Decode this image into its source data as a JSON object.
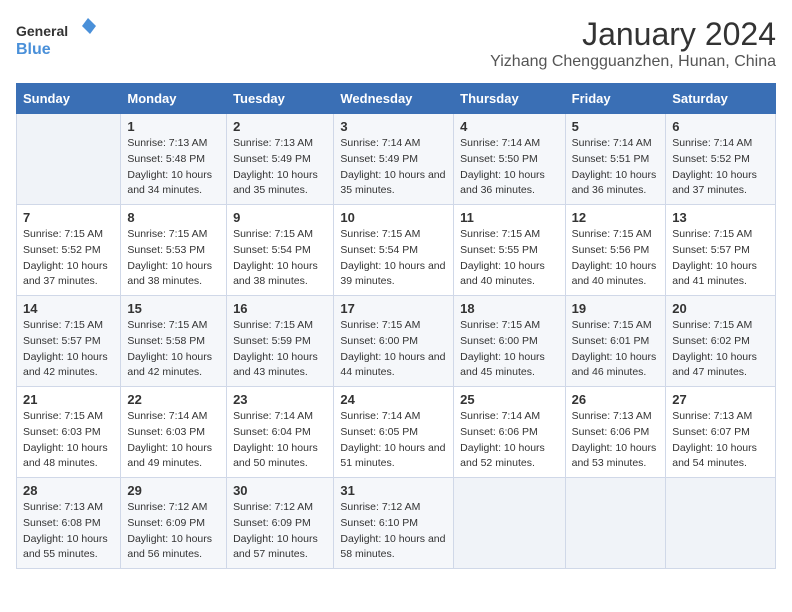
{
  "header": {
    "logo_line1": "General",
    "logo_line2": "Blue",
    "month": "January 2024",
    "location": "Yizhang Chengguanzhen, Hunan, China"
  },
  "days_of_week": [
    "Sunday",
    "Monday",
    "Tuesday",
    "Wednesday",
    "Thursday",
    "Friday",
    "Saturday"
  ],
  "weeks": [
    [
      {
        "day": "",
        "sunrise": "",
        "sunset": "",
        "daylight": ""
      },
      {
        "day": "1",
        "sunrise": "7:13 AM",
        "sunset": "5:48 PM",
        "daylight": "10 hours and 34 minutes."
      },
      {
        "day": "2",
        "sunrise": "7:13 AM",
        "sunset": "5:49 PM",
        "daylight": "10 hours and 35 minutes."
      },
      {
        "day": "3",
        "sunrise": "7:14 AM",
        "sunset": "5:49 PM",
        "daylight": "10 hours and 35 minutes."
      },
      {
        "day": "4",
        "sunrise": "7:14 AM",
        "sunset": "5:50 PM",
        "daylight": "10 hours and 36 minutes."
      },
      {
        "day": "5",
        "sunrise": "7:14 AM",
        "sunset": "5:51 PM",
        "daylight": "10 hours and 36 minutes."
      },
      {
        "day": "6",
        "sunrise": "7:14 AM",
        "sunset": "5:52 PM",
        "daylight": "10 hours and 37 minutes."
      }
    ],
    [
      {
        "day": "7",
        "sunrise": "7:15 AM",
        "sunset": "5:52 PM",
        "daylight": "10 hours and 37 minutes."
      },
      {
        "day": "8",
        "sunrise": "7:15 AM",
        "sunset": "5:53 PM",
        "daylight": "10 hours and 38 minutes."
      },
      {
        "day": "9",
        "sunrise": "7:15 AM",
        "sunset": "5:54 PM",
        "daylight": "10 hours and 38 minutes."
      },
      {
        "day": "10",
        "sunrise": "7:15 AM",
        "sunset": "5:54 PM",
        "daylight": "10 hours and 39 minutes."
      },
      {
        "day": "11",
        "sunrise": "7:15 AM",
        "sunset": "5:55 PM",
        "daylight": "10 hours and 40 minutes."
      },
      {
        "day": "12",
        "sunrise": "7:15 AM",
        "sunset": "5:56 PM",
        "daylight": "10 hours and 40 minutes."
      },
      {
        "day": "13",
        "sunrise": "7:15 AM",
        "sunset": "5:57 PM",
        "daylight": "10 hours and 41 minutes."
      }
    ],
    [
      {
        "day": "14",
        "sunrise": "7:15 AM",
        "sunset": "5:57 PM",
        "daylight": "10 hours and 42 minutes."
      },
      {
        "day": "15",
        "sunrise": "7:15 AM",
        "sunset": "5:58 PM",
        "daylight": "10 hours and 42 minutes."
      },
      {
        "day": "16",
        "sunrise": "7:15 AM",
        "sunset": "5:59 PM",
        "daylight": "10 hours and 43 minutes."
      },
      {
        "day": "17",
        "sunrise": "7:15 AM",
        "sunset": "6:00 PM",
        "daylight": "10 hours and 44 minutes."
      },
      {
        "day": "18",
        "sunrise": "7:15 AM",
        "sunset": "6:00 PM",
        "daylight": "10 hours and 45 minutes."
      },
      {
        "day": "19",
        "sunrise": "7:15 AM",
        "sunset": "6:01 PM",
        "daylight": "10 hours and 46 minutes."
      },
      {
        "day": "20",
        "sunrise": "7:15 AM",
        "sunset": "6:02 PM",
        "daylight": "10 hours and 47 minutes."
      }
    ],
    [
      {
        "day": "21",
        "sunrise": "7:15 AM",
        "sunset": "6:03 PM",
        "daylight": "10 hours and 48 minutes."
      },
      {
        "day": "22",
        "sunrise": "7:14 AM",
        "sunset": "6:03 PM",
        "daylight": "10 hours and 49 minutes."
      },
      {
        "day": "23",
        "sunrise": "7:14 AM",
        "sunset": "6:04 PM",
        "daylight": "10 hours and 50 minutes."
      },
      {
        "day": "24",
        "sunrise": "7:14 AM",
        "sunset": "6:05 PM",
        "daylight": "10 hours and 51 minutes."
      },
      {
        "day": "25",
        "sunrise": "7:14 AM",
        "sunset": "6:06 PM",
        "daylight": "10 hours and 52 minutes."
      },
      {
        "day": "26",
        "sunrise": "7:13 AM",
        "sunset": "6:06 PM",
        "daylight": "10 hours and 53 minutes."
      },
      {
        "day": "27",
        "sunrise": "7:13 AM",
        "sunset": "6:07 PM",
        "daylight": "10 hours and 54 minutes."
      }
    ],
    [
      {
        "day": "28",
        "sunrise": "7:13 AM",
        "sunset": "6:08 PM",
        "daylight": "10 hours and 55 minutes."
      },
      {
        "day": "29",
        "sunrise": "7:12 AM",
        "sunset": "6:09 PM",
        "daylight": "10 hours and 56 minutes."
      },
      {
        "day": "30",
        "sunrise": "7:12 AM",
        "sunset": "6:09 PM",
        "daylight": "10 hours and 57 minutes."
      },
      {
        "day": "31",
        "sunrise": "7:12 AM",
        "sunset": "6:10 PM",
        "daylight": "10 hours and 58 minutes."
      },
      {
        "day": "",
        "sunrise": "",
        "sunset": "",
        "daylight": ""
      },
      {
        "day": "",
        "sunrise": "",
        "sunset": "",
        "daylight": ""
      },
      {
        "day": "",
        "sunrise": "",
        "sunset": "",
        "daylight": ""
      }
    ]
  ],
  "labels": {
    "sunrise_prefix": "Sunrise: ",
    "sunset_prefix": "Sunset: ",
    "daylight_prefix": "Daylight: "
  }
}
